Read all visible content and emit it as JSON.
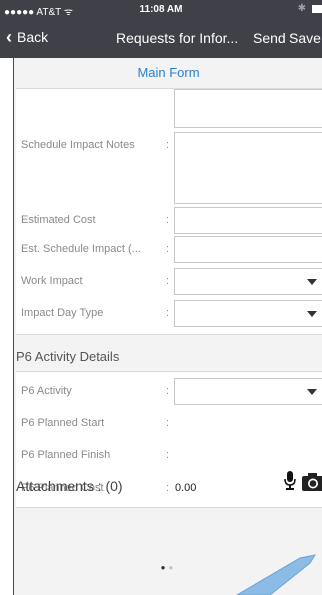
{
  "status_bar": {
    "carrier": "●●●●● AT&T ᯤ",
    "time": "11:08 AM",
    "bluetooth": "✱"
  },
  "nav": {
    "back": "Back",
    "title": "Requests for Infor...",
    "send": "Send",
    "save": "Save"
  },
  "tab": {
    "title": "Main Form"
  },
  "fields": {
    "schedule_impact_notes": {
      "label": "Schedule Impact Notes",
      "colon": ":"
    },
    "estimated_cost": {
      "label": "Estimated Cost",
      "colon": ":"
    },
    "est_schedule_impact": {
      "label": "Est. Schedule Impact (...",
      "colon": ":"
    },
    "work_impact": {
      "label": "Work Impact",
      "colon": ":"
    },
    "impact_day_type": {
      "label": "Impact Day Type",
      "colon": ":"
    }
  },
  "p6": {
    "section_title": "P6 Activity Details",
    "activity": {
      "label": "P6 Activity",
      "colon": ":"
    },
    "planned_start": {
      "label": "P6 Planned Start",
      "colon": ":"
    },
    "planned_finish": {
      "label": "P6 Planned Finish",
      "colon": ":"
    },
    "planned_cost": {
      "label": "P6 Planned Cost",
      "colon": ":",
      "value": "0.00"
    }
  },
  "attachments": {
    "label": "Attachments : (0)",
    "mic_icon": "microphone-icon",
    "camera_icon": "camera-icon"
  },
  "pager": {
    "active": "●",
    "inactive": "●"
  }
}
